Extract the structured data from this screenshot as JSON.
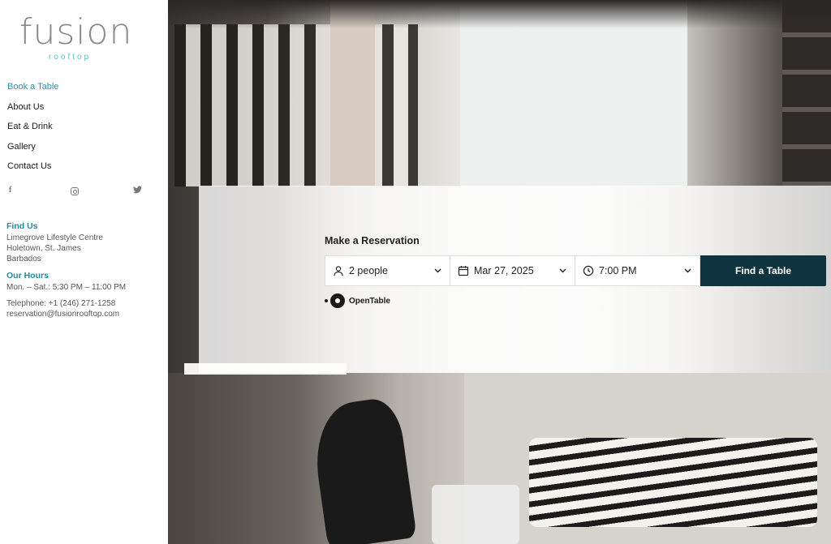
{
  "logo": {
    "main": "fusion",
    "sub": "rooftop"
  },
  "nav": {
    "items": [
      {
        "label": "Book a Table",
        "active": true
      },
      {
        "label": "About Us"
      },
      {
        "label": "Eat & Drink"
      },
      {
        "label": "Gallery"
      },
      {
        "label": "Contact Us"
      }
    ]
  },
  "social": {
    "facebook": "f",
    "instagram": "instagram-icon",
    "twitter": "twitter-icon"
  },
  "find_us": {
    "heading": "Find Us",
    "line1": "Limegrove Lifestyle Centre",
    "line2": "Holetown, St. James",
    "line3": "Barbados"
  },
  "hours": {
    "heading": "Our Hours",
    "line1": "Mon. – Sat.: 5:30 PM – 11:00 PM"
  },
  "contact": {
    "telephone": "Telephone: +1 (246) 271-1258",
    "email": "reservation@fusionrooftop.com"
  },
  "reservation": {
    "title": "Make a Reservation",
    "people": "2 people",
    "date": "Mar 27, 2025",
    "time": "7:00 PM",
    "button": "Find a Table",
    "provider": "OpenTable"
  },
  "colors": {
    "accent": "#2d8fa0",
    "button": "#0f3440",
    "logo_sub": "#55c0c6"
  }
}
